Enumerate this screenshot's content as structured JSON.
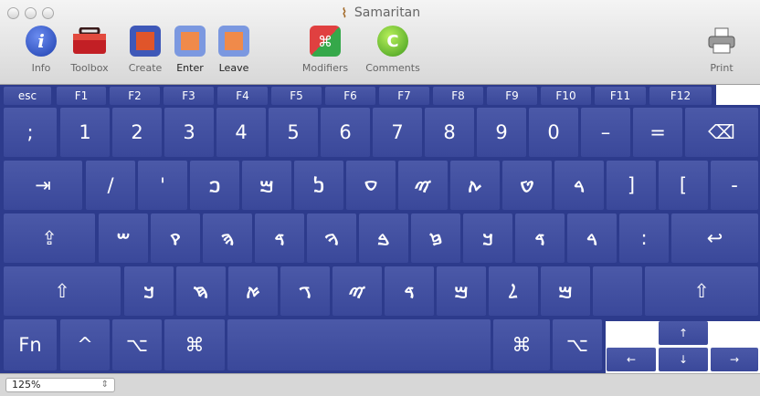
{
  "window": {
    "title": "Samaritan"
  },
  "toolbar": {
    "info": "Info",
    "toolbox": "Toolbox",
    "create": "Create",
    "enter": "Enter",
    "leave": "Leave",
    "modifiers": "Modifiers",
    "comments": "Comments",
    "print": "Print"
  },
  "keyboard": {
    "function_row": [
      "esc",
      "F1",
      "F2",
      "F3",
      "F4",
      "F5",
      "F6",
      "F7",
      "F8",
      "F9",
      "F10",
      "F11",
      "F12"
    ],
    "number_row": [
      ";",
      "1",
      "2",
      "3",
      "4",
      "5",
      "6",
      "7",
      "8",
      "9",
      "0",
      "–",
      "=",
      "⌫"
    ],
    "row2": [
      "⇥",
      "/",
      "'",
      "ࠐ",
      "ࠌ",
      "ࠍ",
      "ࠏ",
      "ࠉ",
      "ࠕ",
      "ࠈ",
      "ࠓ",
      "]",
      "[",
      "-"
    ],
    "row3": [
      "⇪",
      "ࠔ",
      "ࠒ",
      "ࠄ",
      "ࠃ",
      "ࠅ",
      "ࠁ",
      "ࠆ",
      "ࠊ",
      "ࠃ",
      "ࠓ",
      ":",
      "↩"
    ],
    "row4": [
      "⇧",
      "ࠊ",
      "ࠇ",
      "ࠀ",
      "ࠂ",
      "ࠉ",
      "ࠃ",
      "ࠌ",
      "ࠋ",
      "ࠌ",
      "",
      "⇧"
    ],
    "bottom_row": [
      "Fn",
      "^",
      "⌥",
      "⌘",
      "",
      "⌘",
      "⌥"
    ],
    "arrows": {
      "up": "↑",
      "left": "←",
      "down": "↓",
      "right": "→"
    }
  },
  "status": {
    "zoom": "125%"
  },
  "colors": {
    "key_bg": "#4252a2",
    "keyboard_bg": "#2d3b8c"
  }
}
